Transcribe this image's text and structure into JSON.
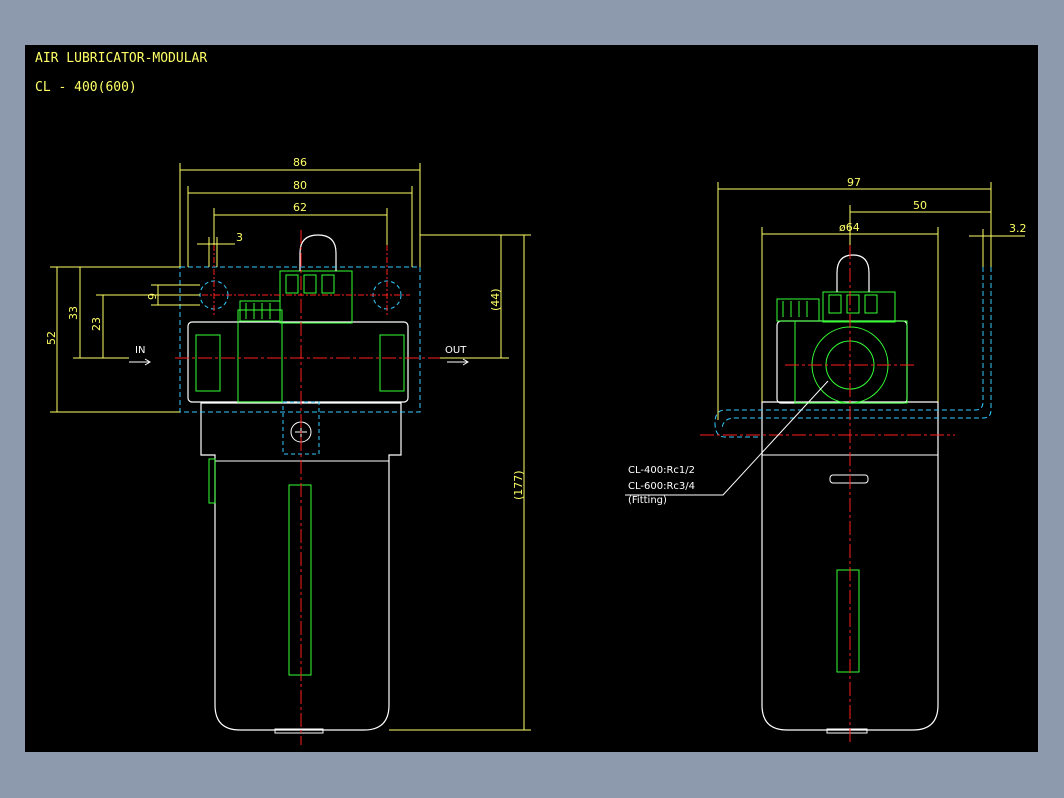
{
  "drawing": {
    "title": "AIR LUBRICATOR-MODULAR",
    "model": "CL - 400(600)",
    "colors": {
      "background": "#000000",
      "frame": "#8d99ad",
      "body_outline": "#ffffff",
      "dimension": "#ffff66",
      "hidden_line": "#33ccff",
      "center_line": "#ff2020",
      "component": "#33ff33"
    }
  },
  "front_view": {
    "dims": {
      "width_86": "86",
      "width_80": "80",
      "width_62": "62",
      "gap_3": "3",
      "height_52": "52",
      "height_33": "33",
      "height_23": "23",
      "height_9": "9",
      "height_44": "(44)",
      "height_177": "(177)"
    },
    "port_in": "IN",
    "port_out": "OUT"
  },
  "side_view": {
    "dims": {
      "width_97": "97",
      "width_50": "50",
      "diameter_64": "ø64",
      "gap_32": "3.2"
    },
    "fitting_notes": [
      "CL-400:Rc1/2",
      "CL-600:Rc3/4",
      "(Fitting)"
    ]
  }
}
